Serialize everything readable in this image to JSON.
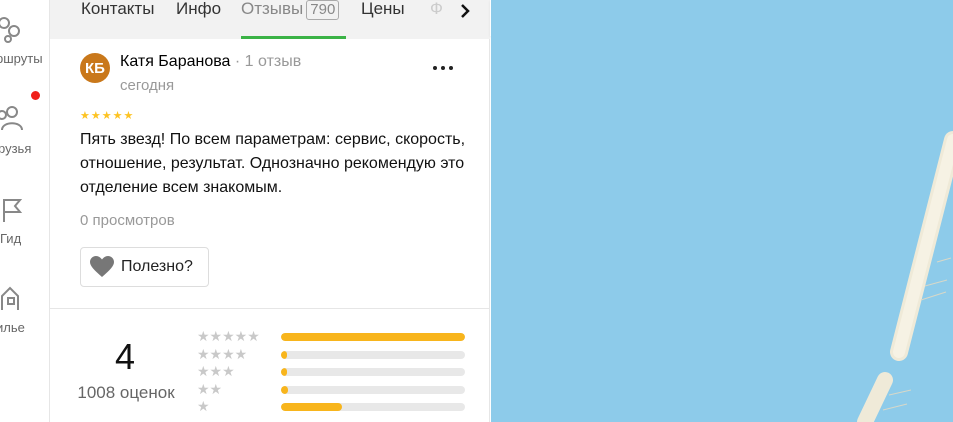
{
  "rail": {
    "items": [
      {
        "label": "ршруты",
        "icon": "route-icon"
      },
      {
        "label": "рузья",
        "icon": "friends-icon"
      },
      {
        "label": "Гид",
        "icon": "guide-flag-icon"
      },
      {
        "label": "илье",
        "icon": "housing-icon"
      }
    ]
  },
  "tabs": {
    "items": [
      "Контакты",
      "Инфо",
      "Отзывы",
      "Цены",
      "Ф"
    ],
    "reviews_count": "790",
    "active": "Отзывы"
  },
  "review": {
    "avatar_initials": "КБ",
    "avatar_color": "#c9781b",
    "author": "Катя Баранова",
    "author_meta": "· 1 отзыв",
    "date": "сегодня",
    "stars": 5,
    "text": "Пять звезд! По всем параметрам: сервис, скорость, отношение, результат. Однозначно рекомендую это отделение всем знакомым.",
    "views": "0 просмотров",
    "useful_label": "Полезно?"
  },
  "rating": {
    "score": "4",
    "count_label": "1008 оценок",
    "distribution": [
      {
        "stars": 5,
        "fraction": 1.0
      },
      {
        "stars": 4,
        "fraction": 0.03
      },
      {
        "stars": 3,
        "fraction": 0.03
      },
      {
        "stars": 2,
        "fraction": 0.04
      },
      {
        "stars": 1,
        "fraction": 0.33
      }
    ]
  },
  "colors": {
    "accent_green": "#3bb346",
    "star_yellow": "#fdc323",
    "bar_fill": "#f8b51c",
    "map_water": "#8dcbea",
    "notification": "#f0201a"
  }
}
